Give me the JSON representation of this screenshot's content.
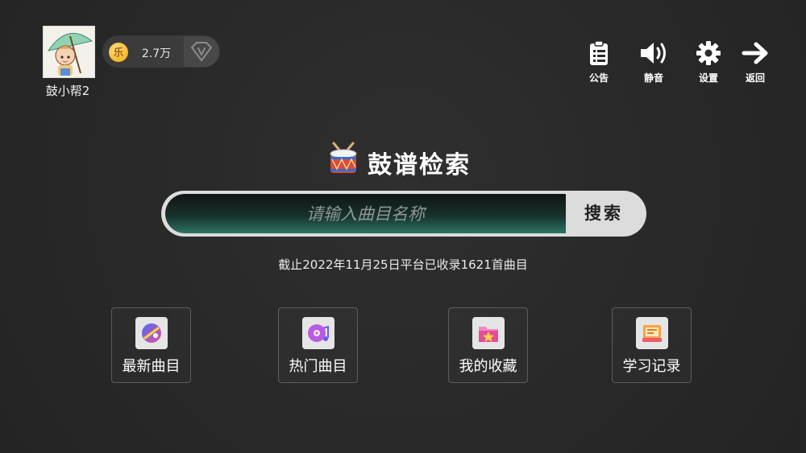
{
  "user": {
    "name": "鼓小帮2",
    "coin_symbol": "乐",
    "coins": "2.7万"
  },
  "actions": [
    {
      "label": "公告",
      "icon": "announcement-icon"
    },
    {
      "label": "静音",
      "icon": "speaker-icon"
    },
    {
      "label": "设置",
      "icon": "gear-icon"
    },
    {
      "label": "返回",
      "icon": "arrow-right-icon"
    }
  ],
  "main": {
    "title": "鼓谱检索",
    "search_placeholder": "请输入曲目名称",
    "search_button": "搜索",
    "notice": "截止2022年11月25日平台已收录1621首曲目"
  },
  "categories": [
    {
      "label": "最新曲目",
      "icon": "new-tracks-icon"
    },
    {
      "label": "热门曲目",
      "icon": "hot-tracks-icon"
    },
    {
      "label": "我的收藏",
      "icon": "favorites-icon"
    },
    {
      "label": "学习记录",
      "icon": "study-record-icon"
    }
  ],
  "colors": {
    "background": "#282828",
    "search_gradient_end": "#2b7462",
    "coin": "#f0a500"
  }
}
